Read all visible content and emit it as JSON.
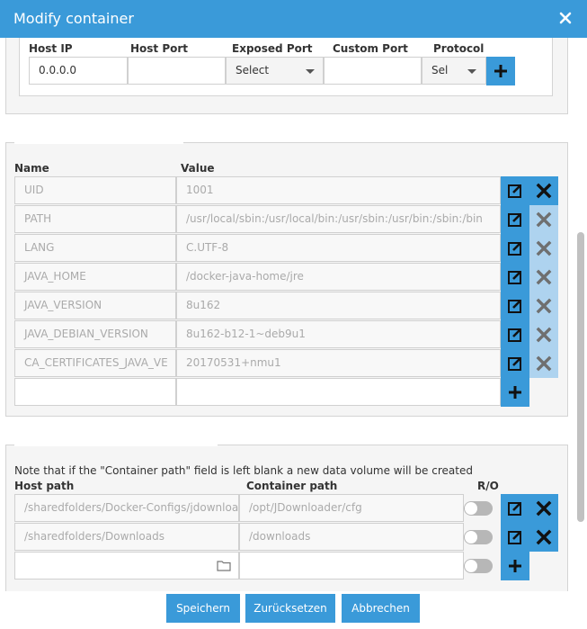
{
  "dialog": {
    "title": "Modify container"
  },
  "ports": {
    "headers": {
      "host_ip": "Host IP",
      "host_port": "Host Port",
      "exposed_port": "Exposed Port",
      "custom_port": "Custom Port",
      "protocol": "Protocol"
    },
    "row": {
      "host_ip": "0.0.0.0",
      "host_port": "",
      "exposed_port": "Select",
      "custom_port": "",
      "protocol": "Sel"
    }
  },
  "env": {
    "headers": {
      "name": "Name",
      "value": "Value"
    },
    "rows": [
      {
        "name": "UID",
        "value": "1001"
      },
      {
        "name": "PATH",
        "value": "/usr/local/sbin:/usr/local/bin:/usr/sbin:/usr/bin:/sbin:/bin"
      },
      {
        "name": "LANG",
        "value": "C.UTF-8"
      },
      {
        "name": "JAVA_HOME",
        "value": "/docker-java-home/jre"
      },
      {
        "name": "JAVA_VERSION",
        "value": "8u162"
      },
      {
        "name": "JAVA_DEBIAN_VERSION",
        "value": "8u162-b12-1~deb9u1"
      },
      {
        "name": "CA_CERTIFICATES_JAVA_VE",
        "value": "20170531+nmu1"
      }
    ],
    "new_row": {
      "name": "",
      "value": ""
    }
  },
  "volumes": {
    "note": "Note that if the \"Container path\" field is left blank a new data volume will be created",
    "headers": {
      "host_path": "Host path",
      "container_path": "Container path",
      "ro": "R/O"
    },
    "rows": [
      {
        "host_path": "/sharedfolders/Docker-Configs/jdownloader",
        "container_path": "/opt/JDownloader/cfg",
        "ro": false
      },
      {
        "host_path": "/sharedfolders/Downloads",
        "container_path": "/downloads",
        "ro": false
      }
    ],
    "new_row": {
      "host_path": "",
      "container_path": ""
    }
  },
  "footer": {
    "save": "Speichern",
    "reset": "Zurücksetzen",
    "cancel": "Abbrechen"
  },
  "colors": {
    "accent": "#3a9ad9",
    "accent_light": "#aed3ef"
  }
}
